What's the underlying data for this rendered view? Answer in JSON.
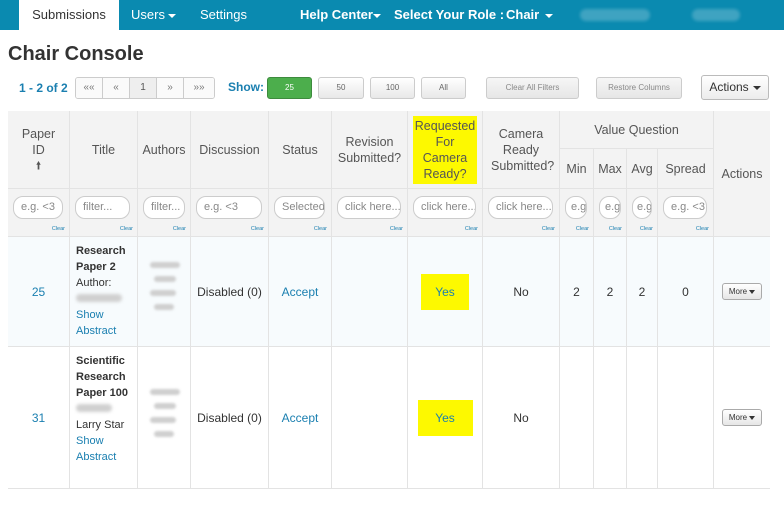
{
  "nav": {
    "submissions": "Submissions",
    "users": "Users",
    "settings": "Settings",
    "help_center": "Help Center",
    "select_role": "Select Your Role :",
    "role": "Chair",
    "bar_color": "#0a8ab0"
  },
  "page": {
    "title": "Chair Console"
  },
  "toolbar": {
    "range": "1 - 2 of 2",
    "pager": [
      "««",
      "«",
      "1",
      "»",
      "»»"
    ],
    "show_label": "Show:",
    "page_sizes": [
      "25",
      "50",
      "100",
      "All"
    ],
    "clear_filters": "Clear All Filters",
    "restore_columns": "Restore Columns",
    "actions": "Actions"
  },
  "table": {
    "headers": {
      "paper_id": "Paper ID",
      "title": "Title",
      "authors": "Authors",
      "discussion": "Discussion",
      "status": "Status",
      "revision": "Revision Submitted?",
      "requested": "Requested For Camera Ready?",
      "camera_ready": "Camera Ready Submitted?",
      "value_question": "Value Question",
      "min": "Min",
      "max": "Max",
      "avg": "Avg",
      "spread": "Spread",
      "actions": "Actions"
    },
    "filters": {
      "paper_id": "e.g. <3",
      "title": "filter...",
      "authors": "filter...",
      "discussion": "e.g. <3",
      "status": "Selected",
      "revision": "click here...",
      "requested": "click here...",
      "camera_ready": "click here...",
      "min": "e.g.",
      "max": "e.g.",
      "avg": "e.g.",
      "spread": "e.g. <3",
      "clear": "Clear"
    },
    "rows": [
      {
        "id": "25",
        "title": "Research Paper 2",
        "author_label": "Author:",
        "show": "Show",
        "abstract": "Abstract",
        "discussion": "Disabled (0)",
        "status": "Accept",
        "requested": "Yes",
        "camera_ready": "No",
        "min": "2",
        "max": "2",
        "avg": "2",
        "spread": "0",
        "more": "More"
      },
      {
        "id": "31",
        "title": "Scientific Research Paper 100",
        "author_name": "Larry Star",
        "show": "Show",
        "abstract": "Abstract",
        "discussion": "Disabled (0)",
        "status": "Accept",
        "requested": "Yes",
        "camera_ready": "No",
        "more": "More"
      }
    ]
  },
  "colors": {
    "accent": "#1a7fb0",
    "highlight": "#fdf900",
    "green": "#4cae4c"
  }
}
